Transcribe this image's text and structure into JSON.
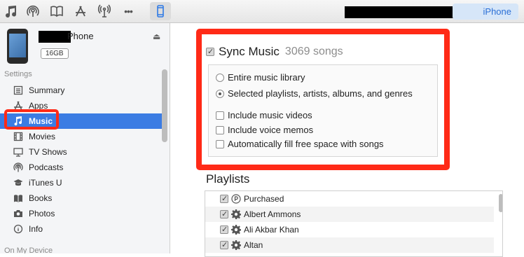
{
  "toolbar": {
    "icons": [
      "music-note-icon",
      "podcast-icon",
      "book-icon",
      "app-store-icon",
      "antenna-icon",
      "more-icon",
      "iphone-device-icon"
    ],
    "more_label": "•••",
    "device_tab_label": "iPhone"
  },
  "device": {
    "name_suffix": "Phone",
    "capacity": "16GB",
    "eject_glyph": "⏏"
  },
  "sidebar": {
    "settings_title": "Settings",
    "items": [
      {
        "label": "Summary",
        "icon": "summary-icon"
      },
      {
        "label": "Apps",
        "icon": "apps-icon"
      },
      {
        "label": "Music",
        "icon": "music-icon",
        "selected": true
      },
      {
        "label": "Movies",
        "icon": "movies-icon"
      },
      {
        "label": "TV Shows",
        "icon": "tv-icon"
      },
      {
        "label": "Podcasts",
        "icon": "podcasts-icon"
      },
      {
        "label": "iTunes U",
        "icon": "itunes-u-icon"
      },
      {
        "label": "Books",
        "icon": "books-icon"
      },
      {
        "label": "Photos",
        "icon": "photos-icon"
      },
      {
        "label": "Info",
        "icon": "info-icon"
      }
    ],
    "on_device_title": "On My Device"
  },
  "main": {
    "sync_label": "Sync Music",
    "sync_checked": true,
    "song_count": "3069 songs",
    "options": [
      {
        "type": "radio",
        "label": "Entire music library",
        "checked": false
      },
      {
        "type": "radio",
        "label": "Selected playlists, artists, albums, and genres",
        "checked": true
      },
      {
        "type": "checkbox",
        "label": "Include music videos",
        "checked": false
      },
      {
        "type": "checkbox",
        "label": "Include voice memos",
        "checked": false
      },
      {
        "type": "checkbox",
        "label": "Automatically fill free space with songs",
        "checked": false
      }
    ],
    "playlists_title": "Playlists",
    "playlists": [
      {
        "label": "Purchased",
        "checked": true,
        "icon": "purchased-icon"
      },
      {
        "label": "Albert Ammons",
        "checked": true,
        "icon": "smart-playlist-gear-icon"
      },
      {
        "label": "Ali Akbar Khan",
        "checked": true,
        "icon": "smart-playlist-gear-icon"
      },
      {
        "label": "Altan",
        "checked": true,
        "icon": "smart-playlist-gear-icon"
      }
    ]
  },
  "colors": {
    "highlight": "#ff2a17",
    "selection": "#3b7ce3",
    "accent": "#2a6fd6"
  }
}
